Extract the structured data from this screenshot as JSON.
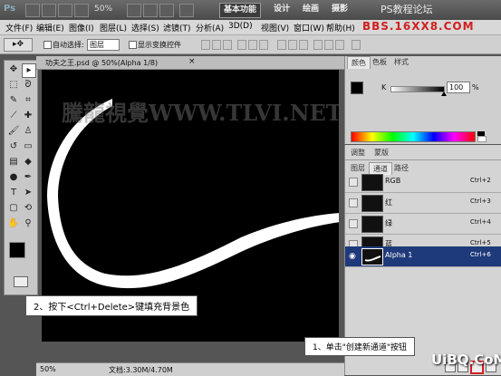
{
  "titlebar": {
    "app_logo": "Ps",
    "zoom": "50%",
    "workspaces": [
      "基本功能",
      "设计",
      "绘画",
      "摄影"
    ],
    "watermark": "PS教程论坛"
  },
  "menubar": {
    "items": [
      "文件(F)",
      "编辑(E)",
      "图像(I)",
      "图层(L)",
      "选择(S)",
      "滤镜(T)",
      "分析(A)",
      "3D(D)",
      "视图(V)",
      "窗口(W)",
      "帮助(H)"
    ],
    "watermark_url": "BBS.16XX8.COM"
  },
  "options": {
    "auto_select_label": "自动选择:",
    "auto_select_value": "图层",
    "show_transform_label": "显示变换控件"
  },
  "document": {
    "tab_title": "功夫之王.psd @ 50%(Alpha 1/8)",
    "canvas_watermark": "騰龍視覺WWW.TLVI.NET",
    "zoom": "50%",
    "doc_info": "文档:3.30M/4.70M"
  },
  "color_panel": {
    "tabs": [
      "颜色",
      "色板",
      "样式"
    ],
    "channel_label": "K",
    "value": "100",
    "unit": "%",
    "value_fraction": 1.0
  },
  "adjust_panel": {
    "tabs": [
      "调整",
      "蒙版"
    ]
  },
  "channels_panel": {
    "tabs": [
      "图层",
      "通道",
      "路径"
    ],
    "rows": [
      {
        "name": "RGB",
        "shortcut": "Ctrl+2"
      },
      {
        "name": "红",
        "shortcut": "Ctrl+3"
      },
      {
        "name": "绿",
        "shortcut": "Ctrl+4"
      },
      {
        "name": "蓝",
        "shortcut": "Ctrl+5"
      },
      {
        "name": "Alpha 1",
        "shortcut": "Ctrl+6"
      }
    ]
  },
  "callouts": {
    "step2": "2、按下<Ctrl+Delete>键填充背景色",
    "step1": "1、单击\"创建新通道\"按钮"
  },
  "footer_logo": "UiBQ.CoM",
  "colors": {
    "selected_row": "#1f3a7a",
    "canvas": "#000000",
    "watermark_red": "#d02020"
  }
}
